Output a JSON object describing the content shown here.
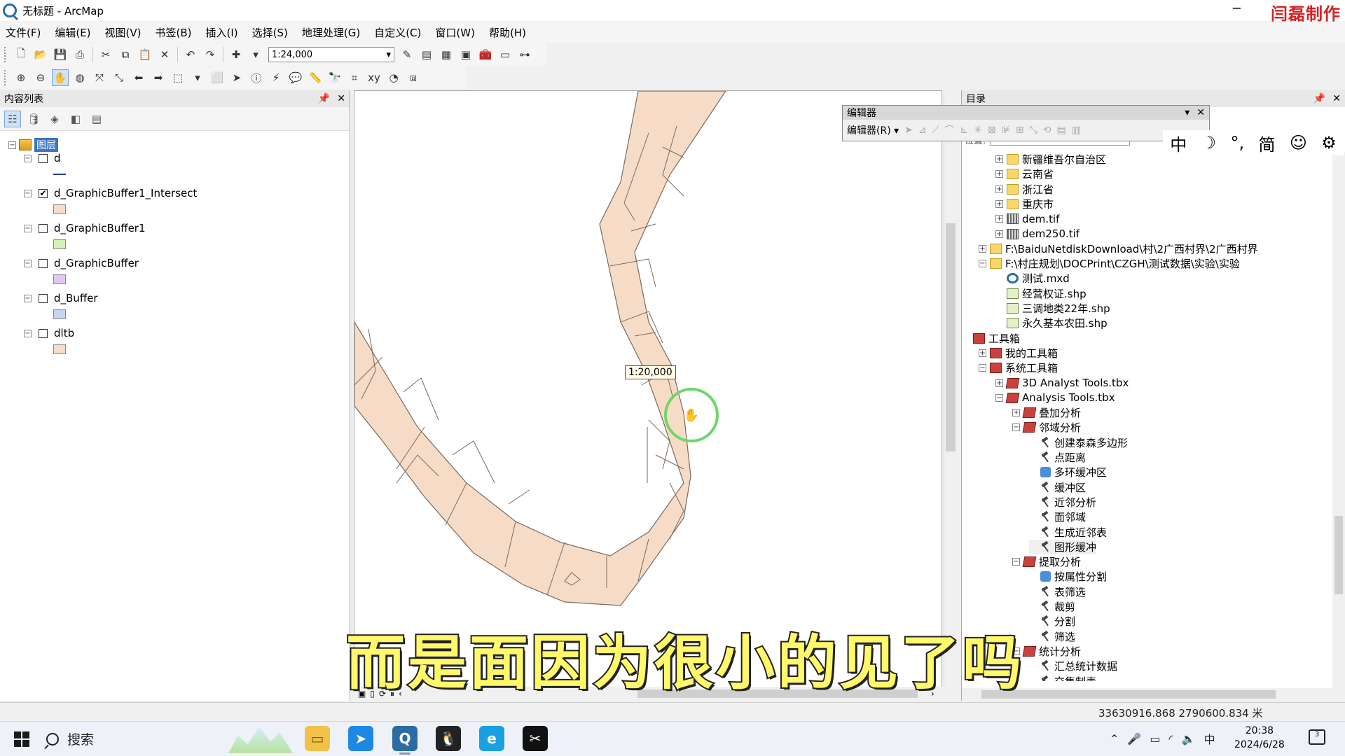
{
  "window": {
    "title": "无标题 - ArcMap",
    "minimize": "─",
    "watermark": "闫磊制作"
  },
  "menu": [
    "文件(F)",
    "编辑(E)",
    "视图(V)",
    "书签(B)",
    "插入(I)",
    "选择(S)",
    "地理处理(G)",
    "自定义(C)",
    "窗口(W)",
    "帮助(H)"
  ],
  "toolbar": {
    "scale_value": "1:24,000"
  },
  "toc": {
    "title": "内容列表",
    "root_label": "图层",
    "layers": [
      {
        "name": "d",
        "checked": false,
        "symbol": "line",
        "color": "#2a3f8f"
      },
      {
        "name": "d_GraphicBuffer1_Intersect",
        "checked": true,
        "symbol": "fill",
        "color": "#f6dcc7"
      },
      {
        "name": "d_GraphicBuffer1",
        "checked": false,
        "symbol": "fill",
        "color": "#d3f0b8"
      },
      {
        "name": "d_GraphicBuffer",
        "checked": false,
        "symbol": "fill",
        "color": "#e3c7f2"
      },
      {
        "name": "d_Buffer",
        "checked": false,
        "symbol": "fill",
        "color": "#c5d5f2"
      },
      {
        "name": "dltb",
        "checked": false,
        "symbol": "fill",
        "color": "#f6dcc7"
      }
    ]
  },
  "map": {
    "scale_tooltip": "1:20,000",
    "feature_fill": "#f6dcc7",
    "feature_stroke": "#7a6a5e",
    "cursor_glyph": "✋"
  },
  "editor": {
    "title": "编辑器",
    "menu_label": "编辑器(R) ▾"
  },
  "ime": [
    "中",
    "☽",
    "°,",
    "简",
    "☺",
    "⚙"
  ],
  "catalog": {
    "title": "目录",
    "location_label": "位置:",
    "items": [
      {
        "label": "新疆维吾尔自治区",
        "icon": "folder",
        "indent": 1,
        "expander": "+"
      },
      {
        "label": "云南省",
        "icon": "folder",
        "indent": 1,
        "expander": "+"
      },
      {
        "label": "浙江省",
        "icon": "folder",
        "indent": 1,
        "expander": "+"
      },
      {
        "label": "重庆市",
        "icon": "folder",
        "indent": 1,
        "expander": "+"
      },
      {
        "label": "dem.tif",
        "icon": "raster",
        "indent": 1,
        "expander": "+"
      },
      {
        "label": "dem250.tif",
        "icon": "raster",
        "indent": 1,
        "expander": "+"
      },
      {
        "label": "F:\\BaiduNetdiskDownload\\村\\2广西村界\\2广西村界",
        "icon": "folder",
        "indent": 0,
        "expander": "+"
      },
      {
        "label": "F:\\村庄规划\\DOCPrint\\CZGH\\测试数据\\实验\\实验",
        "icon": "folder",
        "indent": 0,
        "expander": "−"
      },
      {
        "label": "测试.mxd",
        "icon": "mxd",
        "indent": 1,
        "expander": ""
      },
      {
        "label": "经营权证.shp",
        "icon": "shp",
        "indent": 1,
        "expander": ""
      },
      {
        "label": "三调地类22年.shp",
        "icon": "shp",
        "indent": 1,
        "expander": ""
      },
      {
        "label": "永久基本农田.shp",
        "icon": "shp",
        "indent": 1,
        "expander": ""
      },
      {
        "label": "工具箱",
        "icon": "toolbox",
        "indent": -1,
        "expander": ""
      },
      {
        "label": "我的工具箱",
        "icon": "toolbox",
        "indent": 0,
        "expander": "+"
      },
      {
        "label": "系统工具箱",
        "icon": "toolbox",
        "indent": 0,
        "expander": "−"
      },
      {
        "label": "3D Analyst Tools.tbx",
        "icon": "tbx",
        "indent": 1,
        "expander": "+"
      },
      {
        "label": "Analysis Tools.tbx",
        "icon": "tbx",
        "indent": 1,
        "expander": "−"
      },
      {
        "label": "叠加分析",
        "icon": "tbx",
        "indent": 2,
        "expander": "+"
      },
      {
        "label": "邻域分析",
        "icon": "tbx",
        "indent": 2,
        "expander": "−"
      },
      {
        "label": "创建泰森多边形",
        "icon": "tool",
        "indent": 3,
        "expander": ""
      },
      {
        "label": "点距离",
        "icon": "tool",
        "indent": 3,
        "expander": ""
      },
      {
        "label": "多环缓冲区",
        "icon": "script",
        "indent": 3,
        "expander": ""
      },
      {
        "label": "缓冲区",
        "icon": "tool",
        "indent": 3,
        "expander": ""
      },
      {
        "label": "近邻分析",
        "icon": "tool",
        "indent": 3,
        "expander": ""
      },
      {
        "label": "面邻域",
        "icon": "tool",
        "indent": 3,
        "expander": ""
      },
      {
        "label": "生成近邻表",
        "icon": "tool",
        "indent": 3,
        "expander": ""
      },
      {
        "label": "图形缓冲",
        "icon": "tool",
        "indent": 3,
        "expander": "",
        "highlight": true
      },
      {
        "label": "提取分析",
        "icon": "tbx",
        "indent": 2,
        "expander": "−"
      },
      {
        "label": "按属性分割",
        "icon": "script",
        "indent": 3,
        "expander": ""
      },
      {
        "label": "表筛选",
        "icon": "tool",
        "indent": 3,
        "expander": ""
      },
      {
        "label": "裁剪",
        "icon": "tool",
        "indent": 3,
        "expander": ""
      },
      {
        "label": "分割",
        "icon": "tool",
        "indent": 3,
        "expander": ""
      },
      {
        "label": "筛选",
        "icon": "tool",
        "indent": 3,
        "expander": ""
      },
      {
        "label": "统计分析",
        "icon": "tbx",
        "indent": 2,
        "expander": "−"
      },
      {
        "label": "汇总统计数据",
        "icon": "tool",
        "indent": 3,
        "expander": ""
      },
      {
        "label": "交集制表",
        "icon": "tool",
        "indent": 3,
        "expander": ""
      }
    ]
  },
  "status": {
    "coordinates": "33630916.868  2790600.834 米"
  },
  "subtitle": "而是面因为很小的见了吗",
  "taskbar": {
    "search_label": "搜索",
    "tray_lang": "中",
    "time": "20:38",
    "date": "2024/6/28"
  }
}
